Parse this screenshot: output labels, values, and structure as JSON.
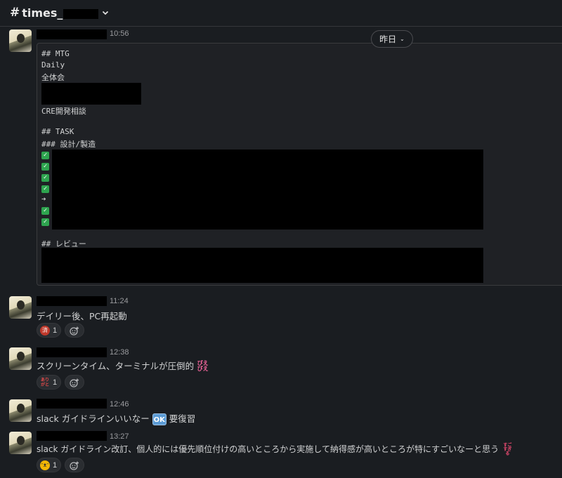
{
  "channel": {
    "hash": "#",
    "name": "times_"
  },
  "day_divider": {
    "label": "昨日"
  },
  "messages": [
    {
      "time": "10:56",
      "code_lines": [
        "## MTG",
        "Daily",
        "全体会",
        "CRE開発相談",
        "## TASK",
        "### 設計/製造",
        "➔",
        "## レビュー"
      ]
    },
    {
      "time": "11:24",
      "text": "デイリー後、PC再起動",
      "reaction_count": "1"
    },
    {
      "time": "12:38",
      "text": "スクリーンタイム、ターミナルが圧倒的",
      "reaction_count": "1"
    },
    {
      "time": "12:46",
      "text": "slack ガイドラインいいなー",
      "text_after": "要復習",
      "inline_emoji": "OK"
    },
    {
      "time": "13:27",
      "text": "slack ガイドライン改訂、個人的には優先順位付けの高いところから実施して納得感が高いところが特にすごいなーと思う",
      "reaction_count": "1"
    }
  ],
  "icons": {
    "channel_menu": "chevron-down-icon",
    "add_reaction": "add-reaction-icon",
    "check": "check-mark-icon"
  },
  "colors": {
    "background": "#1a1d21",
    "check_green": "#2ea44f",
    "ok_blue": "#5b9bd5"
  }
}
